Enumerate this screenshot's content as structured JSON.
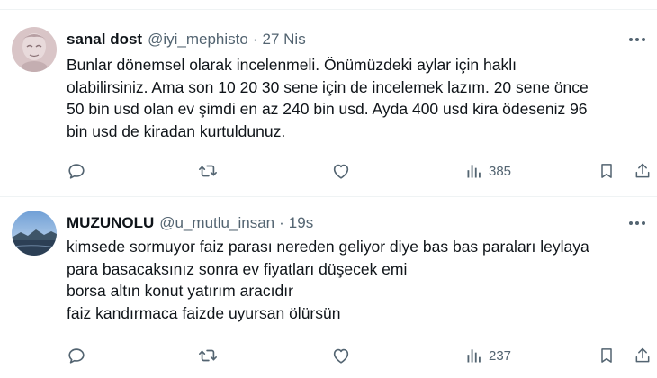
{
  "colors": {
    "text": "#0f1419",
    "secondary": "#536471",
    "divider": "#eff3f4"
  },
  "tweets": [
    {
      "name": "sanal dost",
      "handle": "@iyi_mephisto",
      "separator": "·",
      "time": "27 Nis",
      "lines": [
        "Bunlar dönemsel olarak incelenmeli. Önümüzdeki aylar için haklı",
        "olabilirsiniz.  Ama son 10 20 30 sene için de incelemek lazım. 20 sene önce",
        "50 bin usd olan ev şimdi en az 240 bin usd. Ayda 400 usd kira ödeseniz 96",
        "bin usd de kiradan kurtuldunuz."
      ],
      "views": "385",
      "icons": [
        "more-icon",
        "reply-icon",
        "retweet-icon",
        "like-icon",
        "views-icon",
        "bookmark-icon",
        "share-icon"
      ]
    },
    {
      "name": "MUZUNOLU",
      "handle": "@u_mutlu_insan",
      "separator": "·",
      "time": "19s",
      "lines": [
        "kimsede sormuyor faiz parası nereden geliyor diye bas bas paraları leylaya",
        "para basacaksınız sonra ev fiyatları düşecek emi",
        "borsa altın konut yatırım aracıdır",
        "faiz kandırmaca faizde uyursan ölürsün"
      ],
      "views": "237",
      "icons": [
        "more-icon",
        "reply-icon",
        "retweet-icon",
        "like-icon",
        "views-icon",
        "bookmark-icon",
        "share-icon"
      ]
    }
  ]
}
